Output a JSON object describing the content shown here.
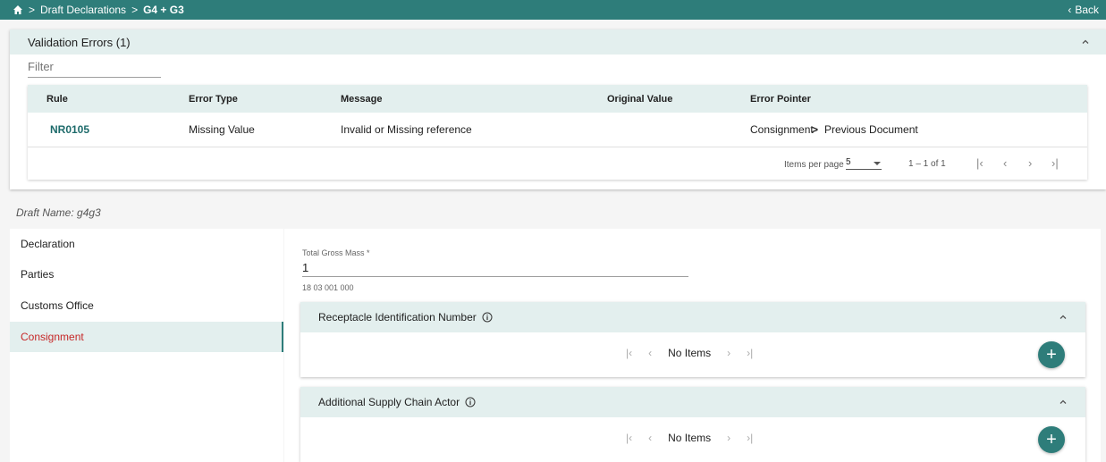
{
  "topbar": {
    "home_icon": "home-icon",
    "sep": ">",
    "crumb1": "Draft Declarations",
    "crumb2": "G4 + G3",
    "back": "Back",
    "back_icon": "‹"
  },
  "validation": {
    "title": "Validation Errors (1)",
    "filter_placeholder": "Filter",
    "columns": [
      "Rule",
      "Error Type",
      "Message",
      "Original Value",
      "Error Pointer"
    ],
    "rows": [
      {
        "rule": "NR0105",
        "type": "Missing Value",
        "message": "Invalid or Missing reference",
        "original": "",
        "pointer_a": "Consignment",
        "pointer_sep": ">",
        "pointer_b": "Previous Document"
      }
    ],
    "pager": {
      "items_per_page_label": "Items per page",
      "per_page": "5",
      "range": "1 – 1 of 1",
      "first": "|‹",
      "prev": "‹",
      "next": "›",
      "last": "›|"
    }
  },
  "draft_name": "Draft Name: g4g3",
  "nav": {
    "items": [
      "Declaration",
      "Parties",
      "Customs Office",
      "Consignment"
    ],
    "active_index": 3
  },
  "main": {
    "total_gross_mass_label": "Total Gross Mass *",
    "total_gross_mass_value": "1",
    "total_gross_mass_hint": "18 03 001 000",
    "panels": [
      {
        "title": "Receptacle Identification Number",
        "no_items": "No Items",
        "add": "+"
      },
      {
        "title": "Additional Supply Chain Actor",
        "no_items": "No Items",
        "add": "+"
      }
    ]
  },
  "colors": {
    "primary": "#2e7d7a",
    "header_bg": "#e3efee",
    "active_text": "#c62828"
  }
}
